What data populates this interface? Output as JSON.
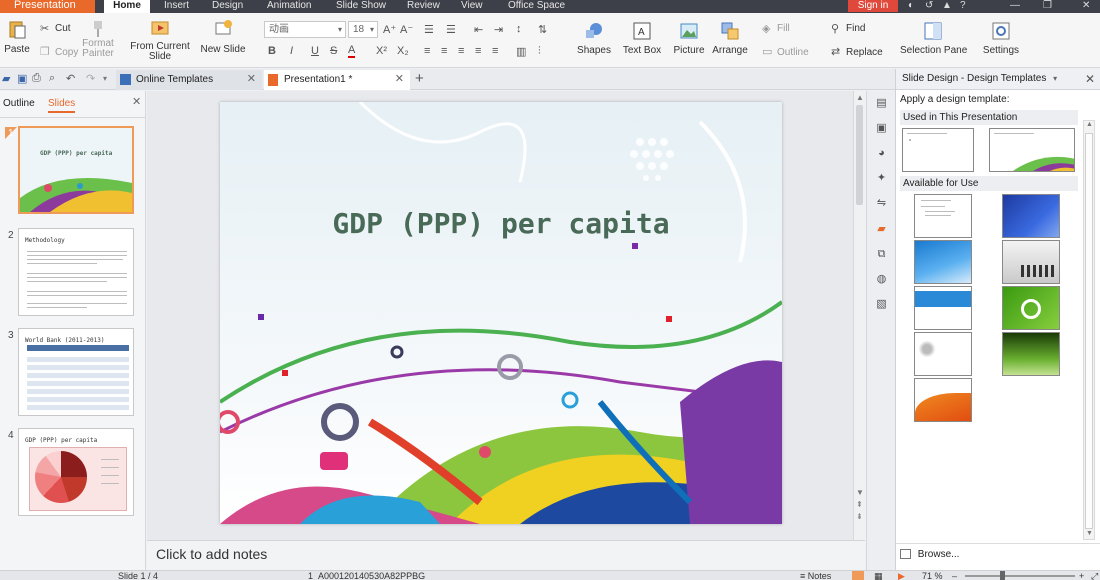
{
  "menubar": {
    "app_label": "Presentation",
    "tabs": [
      "Home",
      "Insert",
      "Design",
      "Animation",
      "Slide Show",
      "Review",
      "View",
      "Office Space"
    ],
    "sign_in": "Sign in"
  },
  "ribbon": {
    "paste": "Paste",
    "cut": "Cut",
    "copy": "Copy",
    "format_painter": "Format Painter",
    "from_current_slide": "From Current Slide",
    "new_slide": "New Slide",
    "font_name": "动画",
    "font_size": "18",
    "shapes": "Shapes",
    "text_box": "Text Box",
    "picture": "Picture",
    "arrange": "Arrange",
    "fill": "Fill",
    "outline": "Outline",
    "find": "Find",
    "replace": "Replace",
    "selection_pane": "Selection Pane",
    "settings": "Settings"
  },
  "tabs": {
    "online_templates": "Online Templates",
    "presentation": "Presentation1 *"
  },
  "left_panel": {
    "outline_tab": "Outline",
    "slides_tab": "Slides",
    "thumbs": [
      {
        "num": "1",
        "title": "GDP (PPP) per capita"
      },
      {
        "num": "2",
        "title": "Methodology"
      },
      {
        "num": "3",
        "title": "World Bank (2011-2013)"
      },
      {
        "num": "4",
        "title": "GDP (PPP) per capita"
      }
    ]
  },
  "slide": {
    "title": "GDP (PPP) per capita"
  },
  "notes_placeholder": "Click to add notes",
  "right_pane": {
    "header": "Slide Design - Design Templates",
    "apply_label": "Apply a design template:",
    "used_section": "Used in This Presentation",
    "available_section": "Available for Use",
    "browse": "Browse..."
  },
  "status": {
    "slide_counter": "Slide 1 / 4",
    "template_id": "1_A000120140530A82PPBG",
    "notes": "Notes",
    "zoom": "71 %"
  },
  "colors": {
    "accent": "#e8692a",
    "title_green": "#4a6a58",
    "menubar_bg": "#3d4048"
  }
}
